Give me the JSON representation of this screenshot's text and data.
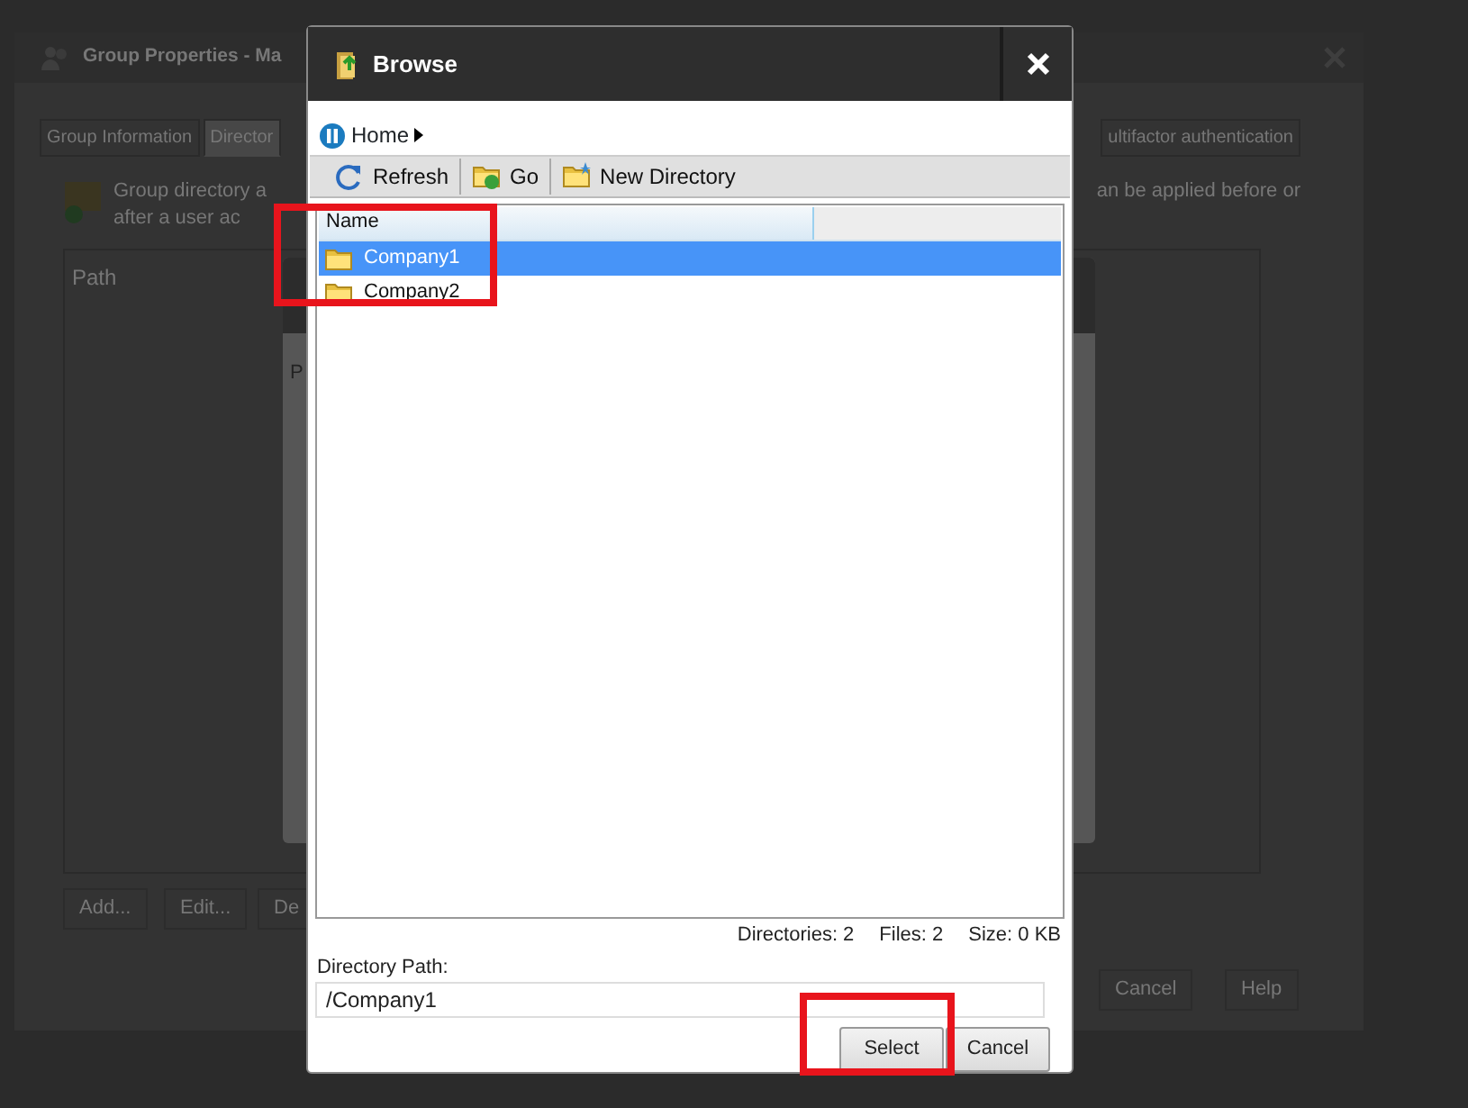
{
  "background_window": {
    "title": "Group Properties - Ma",
    "tabs": [
      {
        "label": "Group Information",
        "selected": false
      },
      {
        "label": "Director",
        "selected": true
      },
      {
        "label": "ultifactor authentication",
        "selected": false
      }
    ],
    "description_left": [
      "Group directory a",
      "after a user ac"
    ],
    "description_right": "an be applied before or",
    "table": {
      "columns": [
        "Path"
      ]
    },
    "inner_dialog": {
      "label": "P"
    },
    "buttons": [
      "Add...",
      "Edit...",
      "De"
    ],
    "footer_buttons": [
      "Cancel",
      "Help"
    ]
  },
  "browse_dialog": {
    "title": "Browse",
    "breadcrumb": [
      {
        "label": "Home"
      }
    ],
    "toolbar": [
      {
        "label": "Refresh",
        "kind": "refresh"
      },
      {
        "label": "Go",
        "kind": "go"
      },
      {
        "label": "New Directory",
        "kind": "new-folder"
      }
    ],
    "columns": [
      "Name"
    ],
    "rows": [
      {
        "name": "Company1",
        "selected": true
      },
      {
        "name": "Company2",
        "selected": false
      }
    ],
    "status": [
      "Directories: 2",
      "Files: 2",
      "Size: 0 KB"
    ],
    "path_label": "Directory Path:",
    "path_value": "/Company1",
    "buttons": [
      "Select",
      "Cancel"
    ]
  },
  "highlight_frames": {
    "file_list": true,
    "select_button": true
  }
}
